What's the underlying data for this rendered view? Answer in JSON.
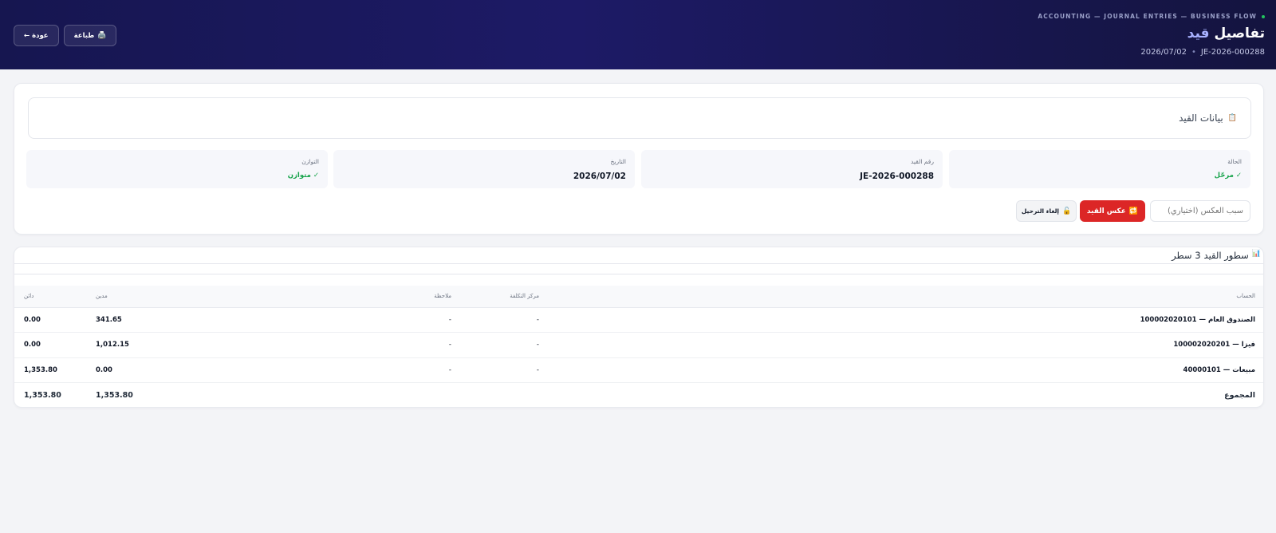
{
  "header": {
    "breadcrumb": "ACCOUNTING — JOURNAL ENTRIES — BUSINESS FLOW",
    "title_main": "تفاصيل",
    "title_highlight": "قيد",
    "entry_no": "JE-2026-000288",
    "date": "2026/07/02",
    "print_label": "طباعة",
    "back_label": "← عودة",
    "print_icon": "🖨️"
  },
  "entry": {
    "section_title": "بيانات القيد",
    "section_icon": "📋",
    "stats": [
      {
        "label": "الحالة",
        "value": "✓ مرحّل"
      },
      {
        "label": "رقم القيد",
        "value": "JE-2026-000288"
      },
      {
        "label": "التاريخ",
        "value": "2026/07/02"
      },
      {
        "label": "التوازن",
        "value": "✓ متوازن"
      }
    ],
    "reason_placeholder": "سبب العكس (اختياري)",
    "reverse_label": "عكس القيد",
    "reverse_icon": "🔁",
    "unpost_label": "إلغاء الترحيل",
    "unpost_icon": "🔓"
  },
  "lines": {
    "icon": "📊",
    "title": "سطور القيد",
    "count_label": "3 سطر",
    "columns": {
      "account": "الحساب",
      "cost_center": "مركز التكلفة",
      "note": "ملاحظة",
      "debit": "مدين",
      "credit": "دائن"
    },
    "rows": [
      {
        "account": "100002020101 — الصندوق العام",
        "cost_center": "-",
        "note": "-",
        "debit": "341.65",
        "credit": "0.00"
      },
      {
        "account": "100002020201 — فيزا",
        "cost_center": "-",
        "note": "-",
        "debit": "1,012.15",
        "credit": "0.00"
      },
      {
        "account": "40000101 — مبيعات",
        "cost_center": "-",
        "note": "-",
        "debit": "0.00",
        "credit": "1,353.80"
      }
    ],
    "total": {
      "label": "المجموع",
      "debit": "1,353.80",
      "credit": "1,353.80"
    }
  },
  "colors": {
    "accent": "#a8b1ff",
    "danger": "#dc2626",
    "success": "#16a34a",
    "header_bg": "#1d1a66"
  }
}
